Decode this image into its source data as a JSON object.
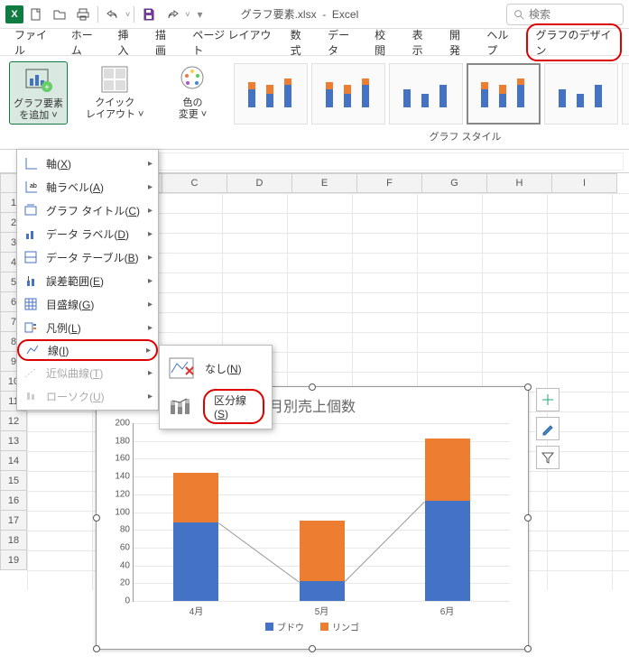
{
  "titlebar": {
    "filename": "グラフ要素.xlsx",
    "app": "Excel",
    "search_placeholder": "検索"
  },
  "tabs": {
    "file": "ファイル",
    "home": "ホーム",
    "insert": "挿入",
    "draw": "描画",
    "layout": "ページ レイアウト",
    "formulas": "数式",
    "data": "データ",
    "review": "校閲",
    "view": "表示",
    "dev": "開発",
    "help": "ヘルプ",
    "chartdesign": "グラフのデザイン"
  },
  "ribbon": {
    "add_element": "グラフ要素\nを追加 ˅",
    "quick_layout": "クイック\nレイアウト ˅",
    "change_colors": "色の\n変更 ˅",
    "styles_label": "グラフ スタイル"
  },
  "menu": {
    "axes": "軸(X)",
    "axis_labels": "軸ラベル(A)",
    "chart_title": "グラフ タイトル(C)",
    "data_labels": "データ ラベル(D)",
    "data_table": "データ テーブル(B)",
    "error_bars": "誤差範囲(E)",
    "gridlines": "目盛線(G)",
    "legend": "凡例(L)",
    "lines": "線(I)",
    "trendline": "近似曲線(T)",
    "updown": "ローソク(U)"
  },
  "submenu": {
    "none": "なし(N)",
    "series_lines": "区分線(S)"
  },
  "columns": [
    "C",
    "D",
    "E",
    "F",
    "G",
    "H",
    "I"
  ],
  "rows": [
    "1",
    "2",
    "3",
    "4",
    "5",
    "6",
    "7",
    "8",
    "9",
    "10",
    "11",
    "12",
    "13",
    "14",
    "15",
    "16",
    "17",
    "18",
    "19"
  ],
  "chart_data": {
    "type": "bar",
    "title": "月別売上個数",
    "categories": [
      "4月",
      "5月",
      "6月"
    ],
    "series": [
      {
        "name": "ブドウ",
        "color": "#4472C4",
        "values": [
          88,
          22,
          112
        ]
      },
      {
        "name": "リンゴ",
        "color": "#ED7D31",
        "values": [
          55,
          68,
          70
        ]
      }
    ],
    "stacked_totals": [
      143,
      90,
      182
    ],
    "ylim": [
      0,
      200
    ],
    "ystep": 20,
    "xlabel": "",
    "ylabel": ""
  }
}
